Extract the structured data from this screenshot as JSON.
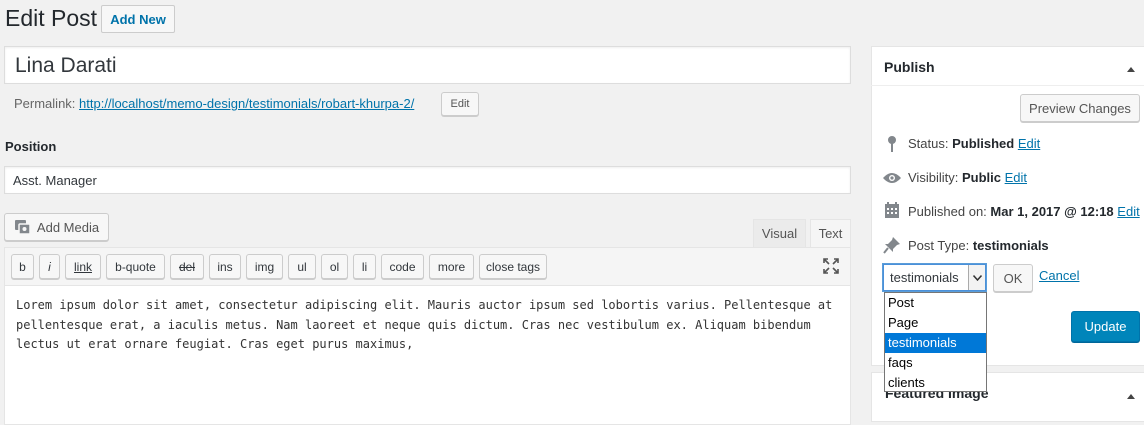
{
  "header": {
    "title": "Edit Post",
    "add_new": "Add New"
  },
  "post": {
    "title": "Lina Darati",
    "permalink_label": "Permalink:",
    "permalink_url": "http://localhost/memo-design/testimonials/robart-khurpa-2/",
    "permalink_edit": "Edit"
  },
  "position": {
    "label": "Position",
    "value": "Asst. Manager"
  },
  "editor": {
    "add_media": "Add Media",
    "tab_visual": "Visual",
    "tab_text": "Text",
    "quicktags": [
      "b",
      "i",
      "link",
      "b-quote",
      "del",
      "ins",
      "img",
      "ul",
      "ol",
      "li",
      "code",
      "more",
      "close tags"
    ],
    "content": "Lorem ipsum dolor sit amet, consectetur adipiscing elit. Mauris auctor ipsum sed lobortis varius. Pellentesque at pellentesque erat, a iaculis metus. Nam laoreet et neque quis dictum. Cras nec vestibulum ex. Aliquam bibendum lectus ut erat ornare feugiat. Cras eget purus maximus,"
  },
  "publish": {
    "title": "Publish",
    "preview": "Preview Changes",
    "status_label": "Status:",
    "status_value": "Published",
    "visibility_label": "Visibility:",
    "visibility_value": "Public",
    "published_on_label": "Published on:",
    "published_on_value": "Mar 1, 2017 @ 12:18",
    "edit": "Edit",
    "post_type_label": "Post Type:",
    "post_type_value": "testimonials",
    "ok": "OK",
    "cancel": "Cancel",
    "update": "Update",
    "select_value": "testimonials",
    "options": [
      "Post",
      "Page",
      "testimonials",
      "faqs",
      "clients"
    ],
    "selected_option": "testimonials"
  },
  "featured_image": {
    "title": "Featured Image"
  },
  "colors": {
    "link": "#0073aa",
    "primary_button": "#0085ba",
    "selection": "#0078d7"
  }
}
